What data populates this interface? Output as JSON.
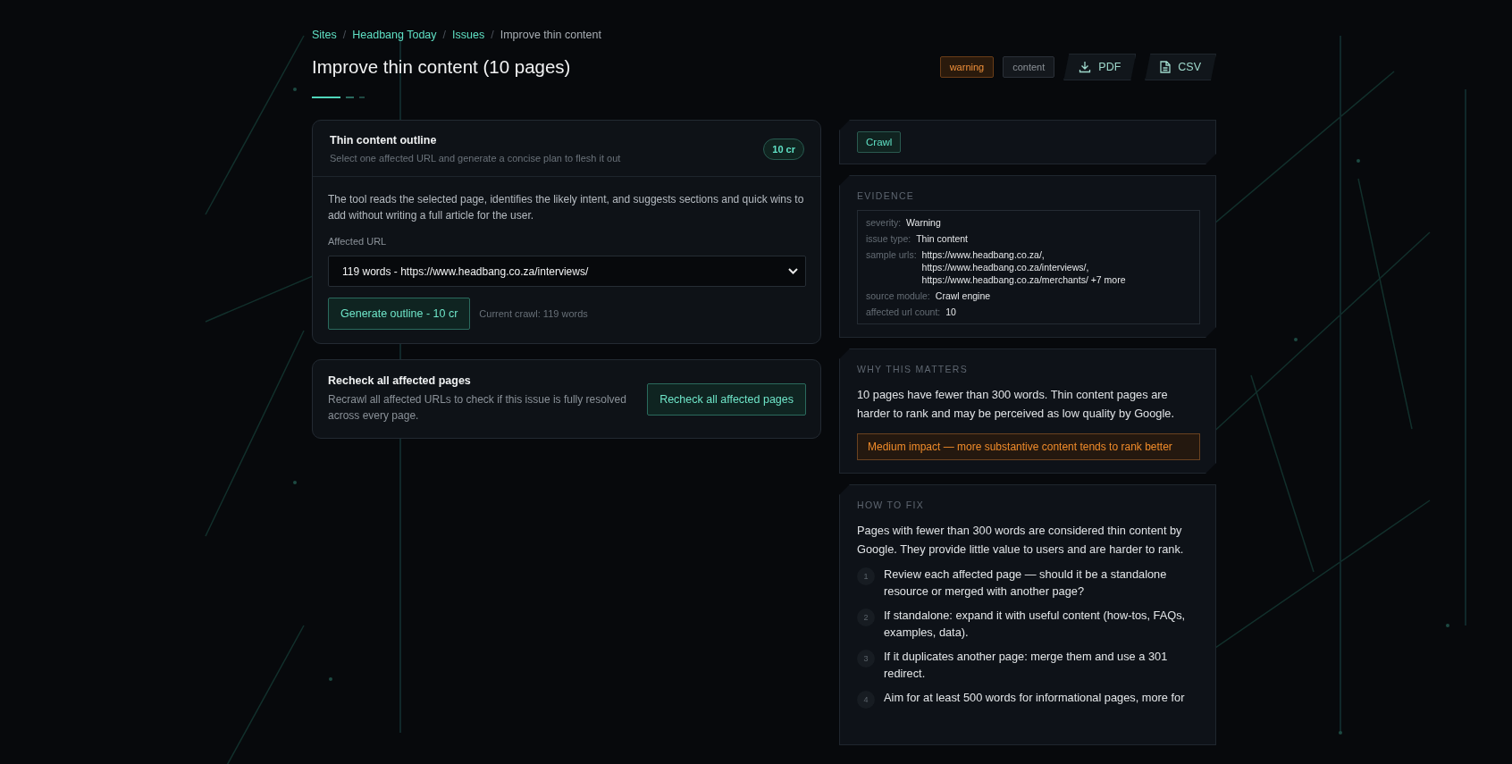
{
  "breadcrumb": [
    {
      "label": "Sites",
      "kind": "link"
    },
    {
      "label": "/",
      "kind": "separator"
    },
    {
      "label": "Headbang Today",
      "kind": "link"
    },
    {
      "label": "/",
      "kind": "separator"
    },
    {
      "label": "Issues",
      "kind": "link"
    },
    {
      "label": "/",
      "kind": "separator"
    },
    {
      "label": "Improve thin content",
      "kind": "current"
    }
  ],
  "title": "Improve thin content (10 pages)",
  "tags": [
    {
      "label": "warning",
      "kind": "severity"
    },
    {
      "label": "content",
      "kind": "category"
    }
  ],
  "exports": [
    {
      "label": "PDF",
      "kind": "download"
    },
    {
      "label": "CSV",
      "kind": "file"
    }
  ],
  "outline_tool": {
    "title": "Thin content outline",
    "subtitle": "Select one affected URL and generate a concise plan to flesh it out",
    "cost": "10 cr",
    "description": "The tool reads the selected page, identifies the likely intent, and suggests sections and quick wins to add without writing a full article for the user.",
    "field_label": "Affected URL",
    "selected_url": "119 words - https://www.headbang.co.za/interviews/",
    "button": "Generate outline - 10 cr",
    "note": "Current crawl: 119 words"
  },
  "recheck": {
    "title": "Recheck all affected pages",
    "description": "Recrawl all affected URLs to check if this issue is fully resolved across every page.",
    "button": "Recheck all affected pages"
  },
  "source_tag": "Crawl",
  "evidence": {
    "heading": "EVIDENCE",
    "rows": [
      {
        "label": "severity:",
        "values": [
          "Warning"
        ]
      },
      {
        "label": "issue type:",
        "values": [
          "Thin content"
        ]
      },
      {
        "label": "sample urls:",
        "values": [
          "https://www.headbang.co.za/,",
          "https://www.headbang.co.za/interviews/,",
          "https://www.headbang.co.za/merchants/ +7 more"
        ]
      },
      {
        "label": "source module:",
        "values": [
          "Crawl engine"
        ]
      },
      {
        "label": "affected url count:",
        "values": [
          "10"
        ]
      }
    ]
  },
  "why": {
    "heading": "WHY THIS MATTERS",
    "text": "10 pages have fewer than 300 words. Thin content pages are harder to rank and may be perceived as low quality by Google.",
    "impact": "Medium impact — more substantive content tends to rank better"
  },
  "how_to_fix": {
    "heading": "HOW TO FIX",
    "text": "Pages with fewer than 300 words are considered thin content by Google. They provide little value to users and are harder to rank.",
    "steps": [
      {
        "number": "1",
        "text": "Review each affected page — should it be a standalone resource or merged with another page?"
      },
      {
        "number": "2",
        "text": "If standalone: expand it with useful content (how-tos, FAQs, examples, data)."
      },
      {
        "number": "3",
        "text": "If it duplicates another page: merge them and use a 301 redirect."
      },
      {
        "number": "4",
        "text": "Aim for at least 500 words for informational pages, more for"
      }
    ]
  }
}
